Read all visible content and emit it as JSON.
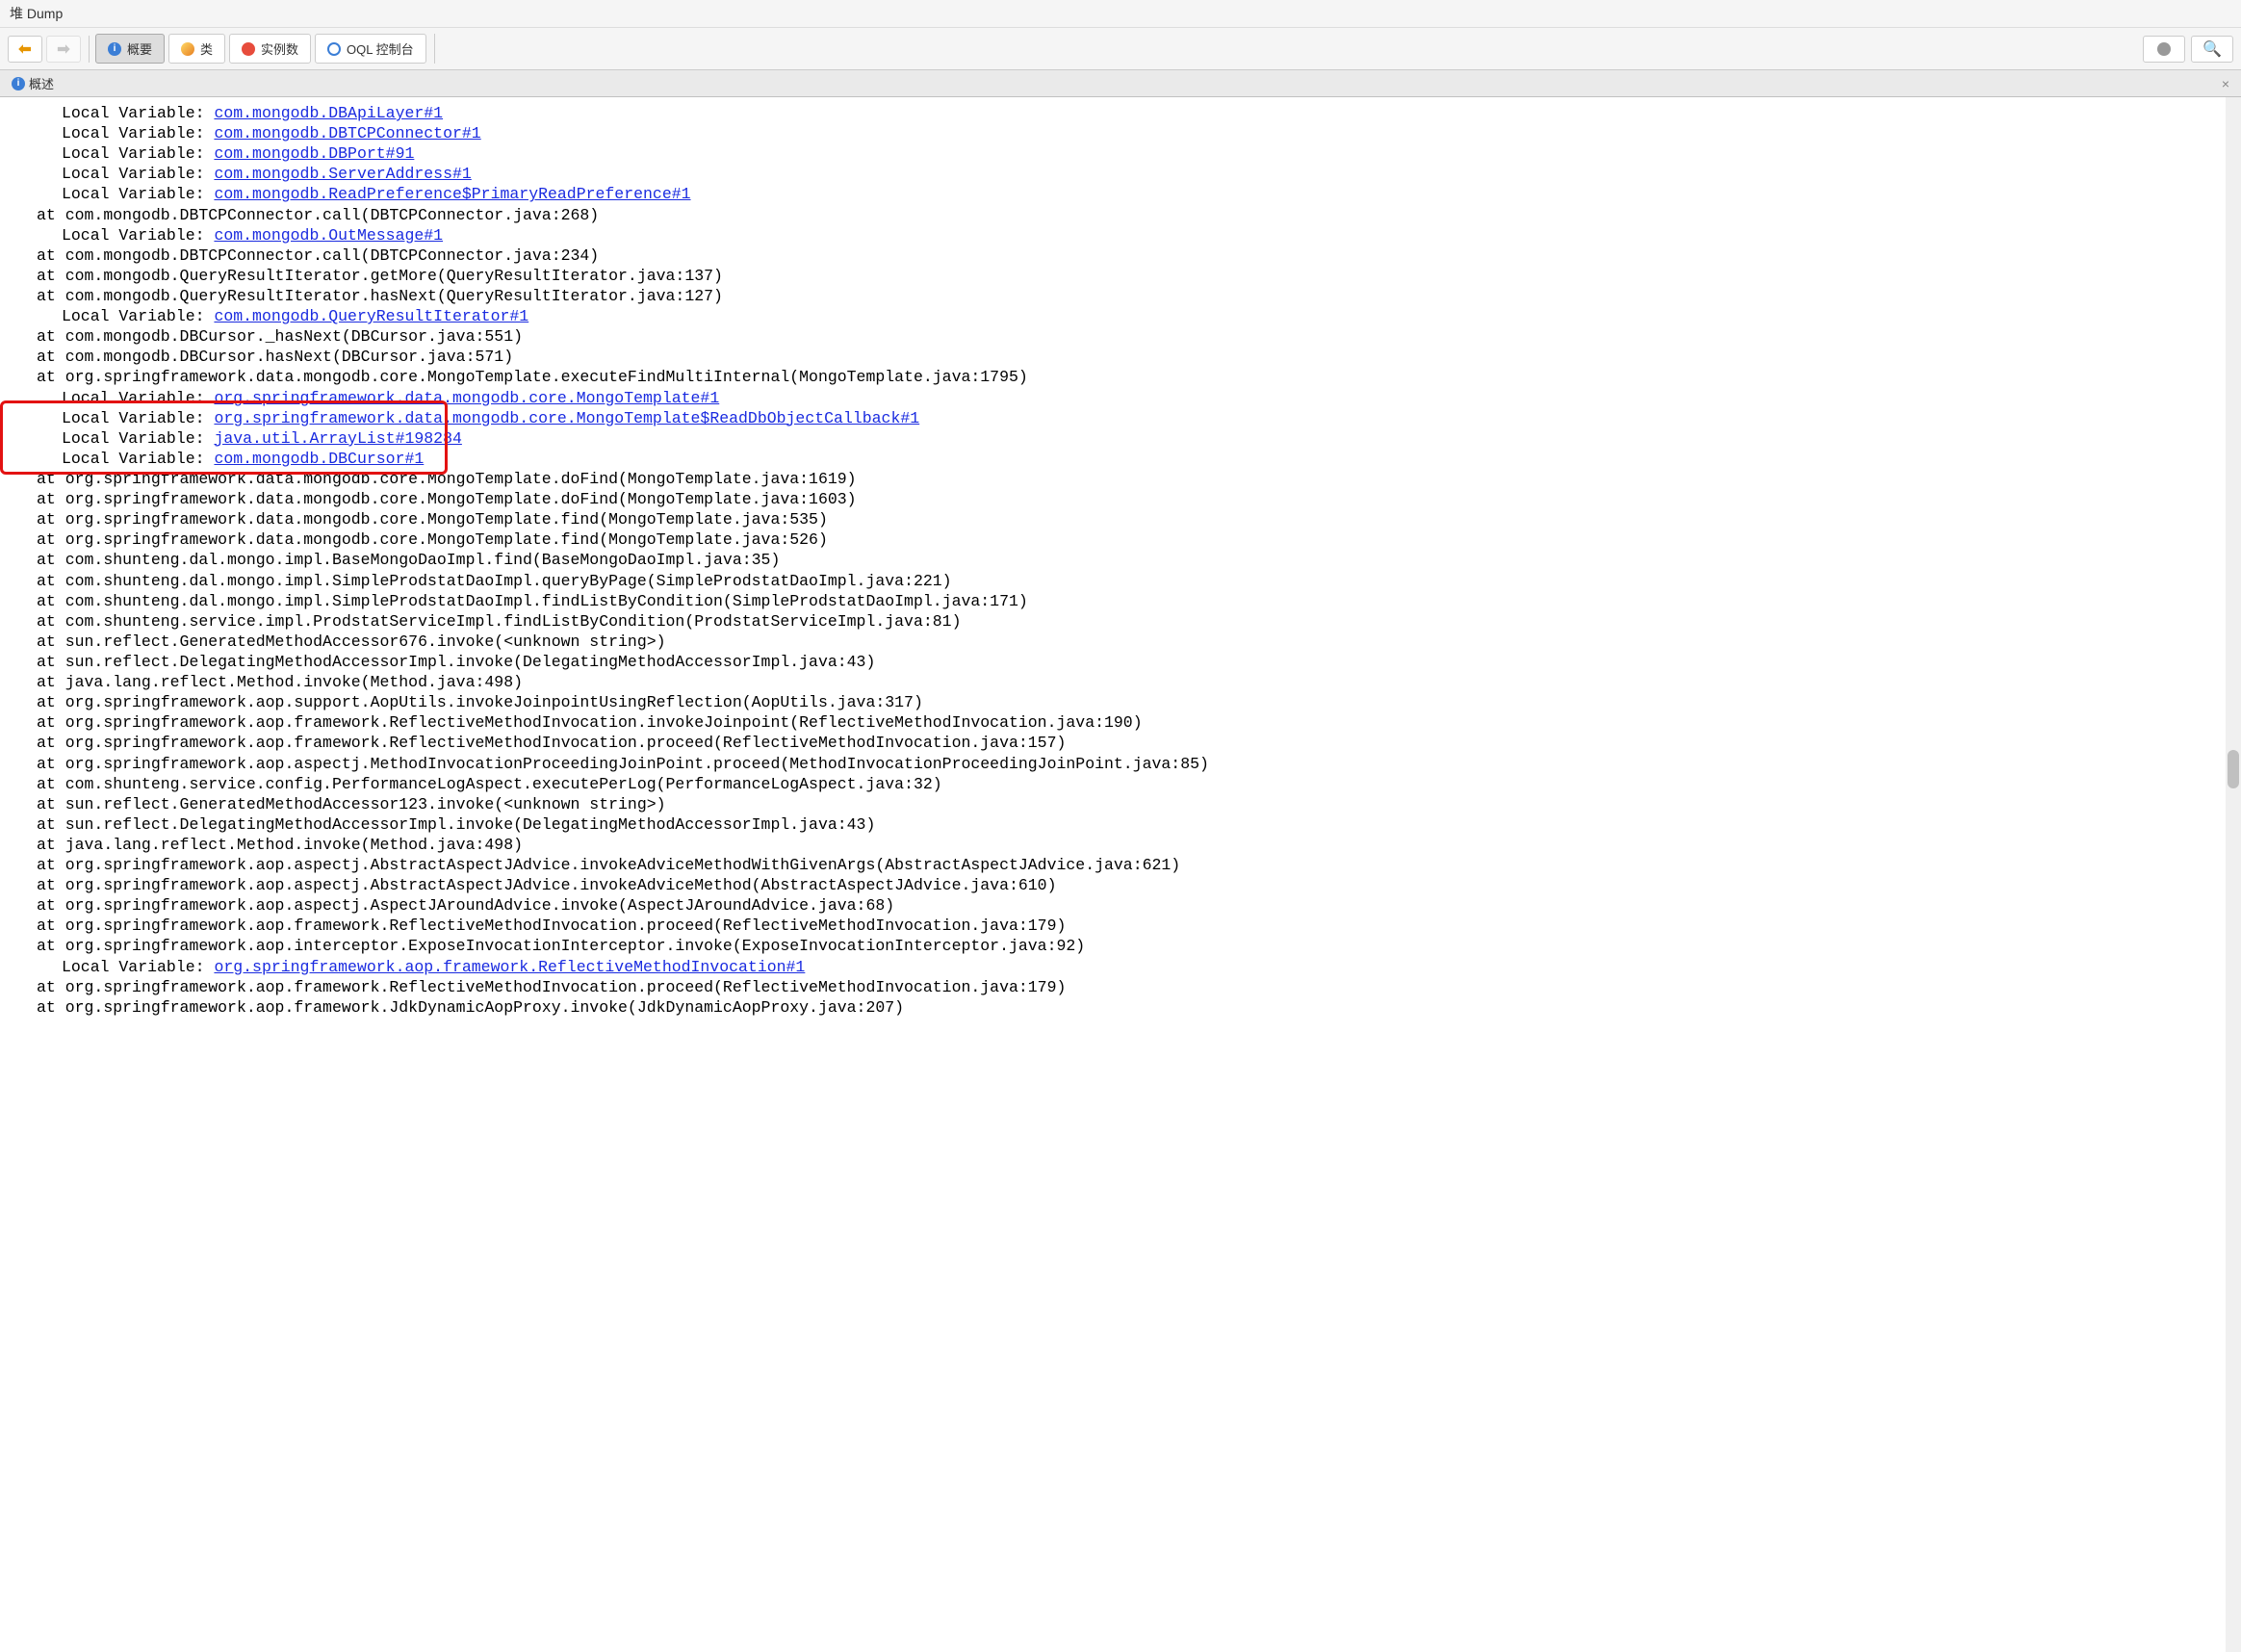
{
  "window": {
    "title": "堆 Dump"
  },
  "toolbar": {
    "overview": "概要",
    "classes": "类",
    "instances": "实例数",
    "oql": "OQL 控制台"
  },
  "tab": {
    "label": "概述"
  },
  "trace": {
    "localVarPrefix": "Local Variable: ",
    "atPrefix": "at ",
    "lines": [
      {
        "type": "localvar",
        "link": "com.mongodb.DBApiLayer#1"
      },
      {
        "type": "localvar",
        "link": "com.mongodb.DBTCPConnector#1"
      },
      {
        "type": "localvar",
        "link": "com.mongodb.DBPort#91"
      },
      {
        "type": "localvar",
        "link": "com.mongodb.ServerAddress#1"
      },
      {
        "type": "localvar",
        "link": "com.mongodb.ReadPreference$PrimaryReadPreference#1"
      },
      {
        "type": "at",
        "text": "com.mongodb.DBTCPConnector.call(DBTCPConnector.java:268)"
      },
      {
        "type": "localvar",
        "link": "com.mongodb.OutMessage#1"
      },
      {
        "type": "at",
        "text": "com.mongodb.DBTCPConnector.call(DBTCPConnector.java:234)"
      },
      {
        "type": "at",
        "text": "com.mongodb.QueryResultIterator.getMore(QueryResultIterator.java:137)"
      },
      {
        "type": "at",
        "text": "com.mongodb.QueryResultIterator.hasNext(QueryResultIterator.java:127)"
      },
      {
        "type": "localvar",
        "link": "com.mongodb.QueryResultIterator#1"
      },
      {
        "type": "at",
        "text": "com.mongodb.DBCursor._hasNext(DBCursor.java:551)"
      },
      {
        "type": "at",
        "text": "com.mongodb.DBCursor.hasNext(DBCursor.java:571)"
      },
      {
        "type": "at",
        "text": "org.springframework.data.mongodb.core.MongoTemplate.executeFindMultiInternal(MongoTemplate.java:1795)"
      },
      {
        "type": "localvar",
        "link": "org.springframework.data.mongodb.core.MongoTemplate#1"
      },
      {
        "type": "localvar",
        "link": "org.springframework.data.mongodb.core.MongoTemplate$ReadDbObjectCallback#1"
      },
      {
        "type": "localvar",
        "link": "java.util.ArrayList#198284"
      },
      {
        "type": "localvar",
        "link": "com.mongodb.DBCursor#1"
      },
      {
        "type": "at",
        "text": "org.springframework.data.mongodb.core.MongoTemplate.doFind(MongoTemplate.java:1619)"
      },
      {
        "type": "at",
        "text": "org.springframework.data.mongodb.core.MongoTemplate.doFind(MongoTemplate.java:1603)"
      },
      {
        "type": "at",
        "text": "org.springframework.data.mongodb.core.MongoTemplate.find(MongoTemplate.java:535)"
      },
      {
        "type": "at",
        "text": "org.springframework.data.mongodb.core.MongoTemplate.find(MongoTemplate.java:526)"
      },
      {
        "type": "at",
        "text": "com.shunteng.dal.mongo.impl.BaseMongoDaoImpl.find(BaseMongoDaoImpl.java:35)"
      },
      {
        "type": "at",
        "text": "com.shunteng.dal.mongo.impl.SimpleProdstatDaoImpl.queryByPage(SimpleProdstatDaoImpl.java:221)"
      },
      {
        "type": "at",
        "text": "com.shunteng.dal.mongo.impl.SimpleProdstatDaoImpl.findListByCondition(SimpleProdstatDaoImpl.java:171)"
      },
      {
        "type": "at",
        "text": "com.shunteng.service.impl.ProdstatServiceImpl.findListByCondition(ProdstatServiceImpl.java:81)"
      },
      {
        "type": "at",
        "text": "sun.reflect.GeneratedMethodAccessor676.invoke(<unknown string>)"
      },
      {
        "type": "at",
        "text": "sun.reflect.DelegatingMethodAccessorImpl.invoke(DelegatingMethodAccessorImpl.java:43)"
      },
      {
        "type": "at",
        "text": "java.lang.reflect.Method.invoke(Method.java:498)"
      },
      {
        "type": "at",
        "text": "org.springframework.aop.support.AopUtils.invokeJoinpointUsingReflection(AopUtils.java:317)"
      },
      {
        "type": "at",
        "text": "org.springframework.aop.framework.ReflectiveMethodInvocation.invokeJoinpoint(ReflectiveMethodInvocation.java:190)"
      },
      {
        "type": "at",
        "text": "org.springframework.aop.framework.ReflectiveMethodInvocation.proceed(ReflectiveMethodInvocation.java:157)"
      },
      {
        "type": "at",
        "text": "org.springframework.aop.aspectj.MethodInvocationProceedingJoinPoint.proceed(MethodInvocationProceedingJoinPoint.java:85)"
      },
      {
        "type": "at",
        "text": "com.shunteng.service.config.PerformanceLogAspect.executePerLog(PerformanceLogAspect.java:32)"
      },
      {
        "type": "at",
        "text": "sun.reflect.GeneratedMethodAccessor123.invoke(<unknown string>)"
      },
      {
        "type": "at",
        "text": "sun.reflect.DelegatingMethodAccessorImpl.invoke(DelegatingMethodAccessorImpl.java:43)"
      },
      {
        "type": "at",
        "text": "java.lang.reflect.Method.invoke(Method.java:498)"
      },
      {
        "type": "at",
        "text": "org.springframework.aop.aspectj.AbstractAspectJAdvice.invokeAdviceMethodWithGivenArgs(AbstractAspectJAdvice.java:621)"
      },
      {
        "type": "at",
        "text": "org.springframework.aop.aspectj.AbstractAspectJAdvice.invokeAdviceMethod(AbstractAspectJAdvice.java:610)"
      },
      {
        "type": "at",
        "text": "org.springframework.aop.aspectj.AspectJAroundAdvice.invoke(AspectJAroundAdvice.java:68)"
      },
      {
        "type": "at",
        "text": "org.springframework.aop.framework.ReflectiveMethodInvocation.proceed(ReflectiveMethodInvocation.java:179)"
      },
      {
        "type": "at",
        "text": "org.springframework.aop.interceptor.ExposeInvocationInterceptor.invoke(ExposeInvocationInterceptor.java:92)"
      },
      {
        "type": "localvar",
        "link": "org.springframework.aop.framework.ReflectiveMethodInvocation#1"
      },
      {
        "type": "at",
        "text": "org.springframework.aop.framework.ReflectiveMethodInvocation.proceed(ReflectiveMethodInvocation.java:179)"
      },
      {
        "type": "at",
        "text": "org.springframework.aop.framework.JdkDynamicAopProxy.invoke(JdkDynamicAopProxy.java:207)"
      }
    ]
  },
  "highlight": {
    "startLine": 15,
    "endLine": 17
  }
}
